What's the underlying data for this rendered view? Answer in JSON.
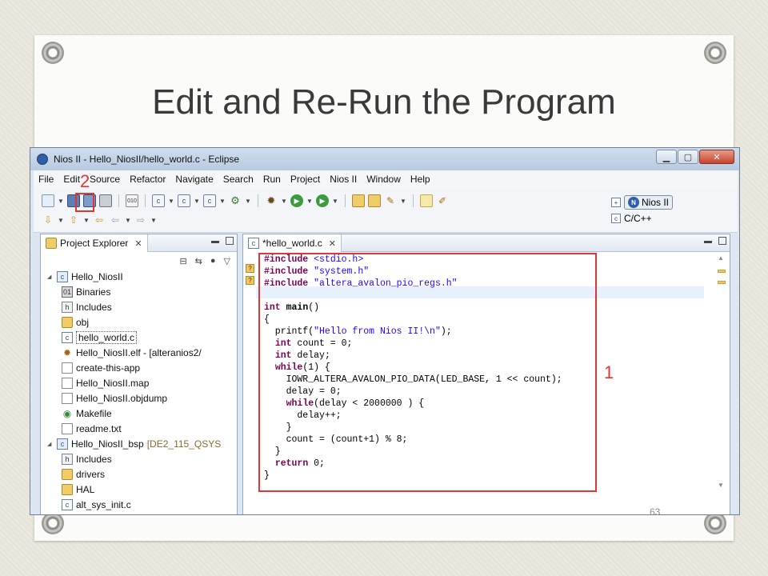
{
  "slide": {
    "title": "Edit and Re-Run the Program",
    "page_number": "63"
  },
  "window": {
    "title": "Nios II - Hello_NiosII/hello_world.c - Eclipse",
    "buttons": [
      "minimize-button",
      "maximize-button",
      "close-button"
    ]
  },
  "menu": [
    "File",
    "Edit",
    "Source",
    "Refactor",
    "Navigate",
    "Search",
    "Run",
    "Project",
    "Nios II",
    "Window",
    "Help"
  ],
  "perspectives": {
    "active": "Nios II",
    "other": "C/C++"
  },
  "explorer": {
    "tab_label": "Project Explorer",
    "tree": [
      {
        "label": "Hello_NiosII",
        "icon": "project-icon",
        "level": 0,
        "expanded": true
      },
      {
        "label": "Binaries",
        "icon": "binaries-icon",
        "level": 1
      },
      {
        "label": "Includes",
        "icon": "includes-icon",
        "level": 1
      },
      {
        "label": "obj",
        "icon": "folder-icon",
        "level": 1
      },
      {
        "label": "hello_world.c",
        "icon": "c-file-icon",
        "level": 1,
        "selected": true
      },
      {
        "label": "Hello_NiosII.elf - [alteranios2/",
        "icon": "elf-icon",
        "level": 1
      },
      {
        "label": "create-this-app",
        "icon": "document-icon",
        "level": 1
      },
      {
        "label": "Hello_NiosII.map",
        "icon": "document-icon",
        "level": 1
      },
      {
        "label": "Hello_NiosII.objdump",
        "icon": "document-icon",
        "level": 1
      },
      {
        "label": "Makefile",
        "icon": "makefile-icon",
        "level": 1
      },
      {
        "label": "readme.txt",
        "icon": "document-icon",
        "level": 1
      },
      {
        "label": "Hello_NiosII_bsp",
        "extra": "[DE2_115_QSYS",
        "icon": "project-icon",
        "level": 0,
        "expanded": true
      },
      {
        "label": "Includes",
        "icon": "includes-icon",
        "level": 1
      },
      {
        "label": "drivers",
        "icon": "folder-icon",
        "level": 1
      },
      {
        "label": "HAL",
        "icon": "folder-icon",
        "level": 1
      },
      {
        "label": "alt_sys_init.c",
        "icon": "c-file-icon",
        "level": 1
      }
    ]
  },
  "editor": {
    "tab_label": "*hello_world.c",
    "code_lines": [
      "#include <stdio.h>",
      "#include \"system.h\"",
      "#include \"altera_avalon_pio_regs.h\"",
      "",
      "int main()",
      "{",
      "  printf(\"Hello from Nios II!\\n\");",
      "  int count = 0;",
      "  int delay;",
      "  while(1) {",
      "    IOWR_ALTERA_AVALON_PIO_DATA(LED_BASE, 1 << count);",
      "    delay = 0;",
      "    while(delay < 2000000 ) {",
      "      delay++;",
      "    }",
      "    count = (count+1) % 8;",
      "  }",
      "  return 0;",
      "}"
    ]
  },
  "annotations": {
    "code_marker": "1",
    "save_marker": "2",
    "color": "#e03636"
  }
}
